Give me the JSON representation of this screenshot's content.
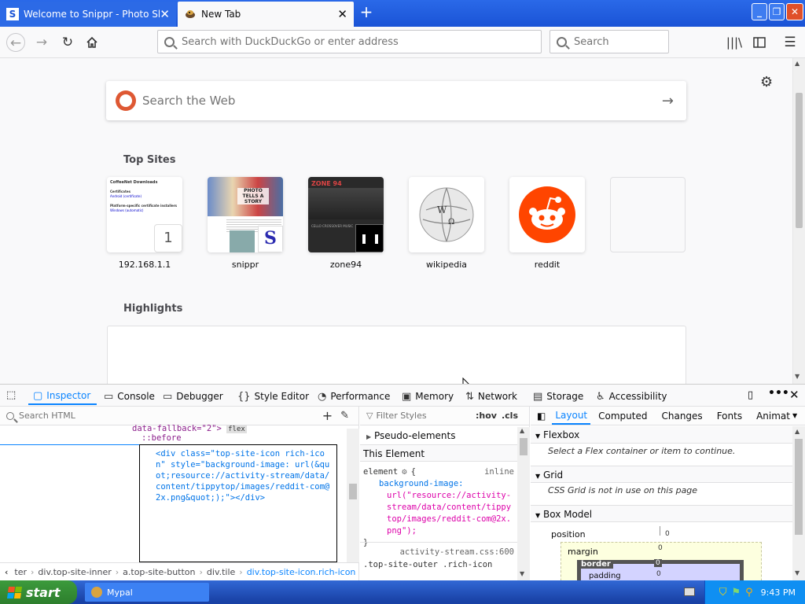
{
  "tabs": [
    {
      "label": "Welcome to Snippr - Photo Sharing",
      "close": "✕"
    },
    {
      "label": "New Tab",
      "close": "✕"
    }
  ],
  "window_controls": {
    "minimize": "_",
    "maximize": "❐",
    "close": "✕"
  },
  "nav": {
    "url_placeholder": "Search with DuckDuckGo or enter address",
    "search_placeholder": "Search"
  },
  "newtab": {
    "search_placeholder": "Search the Web",
    "top_sites_title": "Top Sites",
    "highlights_title": "Highlights",
    "sites": [
      {
        "label": "192.168.1.1",
        "badge": "1"
      },
      {
        "label": "snippr"
      },
      {
        "label": "zone94"
      },
      {
        "label": "wikipedia"
      },
      {
        "label": "reddit"
      },
      {
        "label": ""
      }
    ],
    "thumb_192": {
      "heading": "CoffeeNet Downloads",
      "line1": "Certificates",
      "line2": "Platform-specific certificate installers",
      "link1": "Android (certificate)",
      "link2": "Windows (automatic)"
    },
    "thumb_snippr": {
      "headline": "PHOTO TELLS A STORY",
      "logo": "S"
    },
    "thumb_zone94": {
      "title": "ZONE 94",
      "subtitle": "CELLO CROSSOVER MUSIC"
    }
  },
  "devtools": {
    "tabs": [
      "Inspector",
      "Console",
      "Debugger",
      "Style Editor",
      "Performance",
      "Memory",
      "Network",
      "Storage",
      "Accessibility"
    ],
    "search_html_placeholder": "Search HTML",
    "html_tree": {
      "line0": "data-fallback=\"2\">",
      "line0_tail": "flex",
      "before": "::before",
      "code": "<div class=\"top-site-icon rich-icon\" style=\"background-image: url(&quot;resource://activity-stream/data/content/tippytop/images/reddit-com@2x.png&quot;);\"></div>"
    },
    "breadcrumbs": [
      "ter",
      "div.top-site-inner",
      "a.top-site-button",
      "div.tile",
      "div.top-site-icon.rich-icon"
    ],
    "rules": {
      "filter_placeholder": "Filter Styles",
      "hov": ":hov",
      "cls": ".cls",
      "pseudo": "Pseudo-elements",
      "this_element": "This Element",
      "element_selector": "element",
      "inline": "inline",
      "prop": "background-image:",
      "value": "url(\"resource://activity-stream/data/content/tippytop/images/reddit-com@2x.png\");",
      "close_brace": "}",
      "source": "activity-stream.css:600",
      "selector2": ".top-site-outer .rich-icon"
    },
    "layout_tabs": [
      "Layout",
      "Computed",
      "Changes",
      "Fonts",
      "Animat"
    ],
    "layout": {
      "flexbox": "Flexbox",
      "flexbox_msg": "Select a Flex container or item to continue.",
      "grid": "Grid",
      "grid_msg": "CSS Grid is not in use on this page",
      "box_model": "Box Model",
      "position": "position",
      "position_val": "0",
      "margin": "margin",
      "margin_val": "0",
      "border": "border",
      "border_val": "0",
      "padding": "padding",
      "padding_val": "0"
    }
  },
  "taskbar": {
    "start": "start",
    "item": "Mypal",
    "clock": "9:43 PM"
  }
}
